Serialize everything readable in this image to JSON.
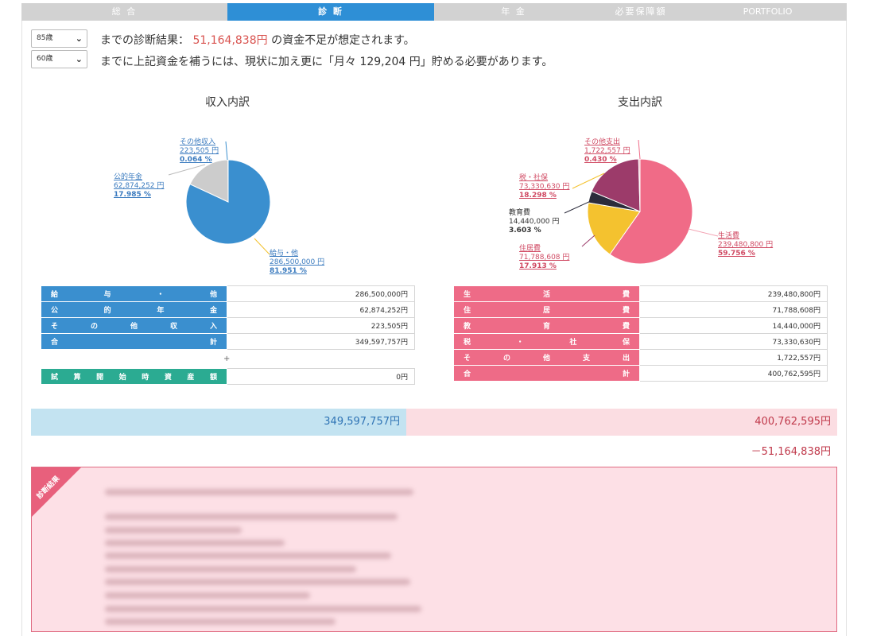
{
  "tabs": [
    {
      "label": "総 合"
    },
    {
      "label": "診 断"
    },
    {
      "label": "年 金"
    },
    {
      "label": "必要保障額"
    },
    {
      "label": "PORTFOLIO"
    }
  ],
  "filters": {
    "age_end": "85歳",
    "age_start": "60歳"
  },
  "diagnosis": {
    "line1_pre": "までの診断結果：",
    "line1_amount": "51,164,838円",
    "line1_post": "の資金不足が想定されます。",
    "line2": "までに上記資金を補うには、現状に加え更に「月々 129,204 円」貯める必要があります。"
  },
  "income": {
    "title": "収入内訳",
    "labels": [
      {
        "name": "その他収入",
        "value": "223,505 円",
        "pct": "0.064 %"
      },
      {
        "name": "公的年金",
        "value": "62,874,252 円",
        "pct": "17.985 %"
      },
      {
        "name": "給与・他",
        "value": "286,500,000 円",
        "pct": "81.951 %"
      }
    ],
    "rows": [
      {
        "label": [
          "給",
          "与",
          "・",
          "他"
        ],
        "value": "286,500,000円"
      },
      {
        "label": [
          "公",
          "的",
          "年",
          "金"
        ],
        "value": "62,874,252円"
      },
      {
        "label": [
          "そ",
          "の",
          "他",
          "収",
          "入"
        ],
        "value": "223,505円"
      },
      {
        "label": [
          "合",
          "計"
        ],
        "value": "349,597,757円"
      }
    ],
    "plus": "+",
    "assets": {
      "label": [
        "試",
        "算",
        "開",
        "始",
        "時",
        "資",
        "産",
        "額"
      ],
      "value": "0円"
    }
  },
  "expense": {
    "title": "支出内訳",
    "labels": [
      {
        "name": "その他支出",
        "value": "1,722,557 円",
        "pct": "0.430 %"
      },
      {
        "name": "税・社保",
        "value": "73,330,630 円",
        "pct": "18.298 %"
      },
      {
        "name": "教育費",
        "value": "14,440,000 円",
        "pct": "3.603 %"
      },
      {
        "name": "住居費",
        "value": "71,788,608 円",
        "pct": "17.913 %"
      },
      {
        "name": "生活費",
        "value": "239,480,800 円",
        "pct": "59.756 %"
      }
    ],
    "rows": [
      {
        "label": [
          "生",
          "活",
          "費"
        ],
        "value": "239,480,800円"
      },
      {
        "label": [
          "住",
          "居",
          "費"
        ],
        "value": "71,788,608円"
      },
      {
        "label": [
          "教",
          "育",
          "費"
        ],
        "value": "14,440,000円"
      },
      {
        "label": [
          "税",
          "・",
          "社",
          "保"
        ],
        "value": "73,330,630円"
      },
      {
        "label": [
          "そ",
          "の",
          "他",
          "支",
          "出"
        ],
        "value": "1,722,557円"
      },
      {
        "label": [
          "合",
          "計"
        ],
        "value": "400,762,595円"
      }
    ]
  },
  "totals": {
    "income": "349,597,757円",
    "expense": "400,762,595円",
    "deficit": "－51,164,838円"
  },
  "result": {
    "ribbon": "診断結果"
  },
  "chart_data": [
    {
      "type": "pie",
      "title": "収入内訳",
      "categories": [
        "給与・他",
        "公的年金",
        "その他収入"
      ],
      "values": [
        286500000,
        62874252,
        223505
      ],
      "percent": [
        81.951,
        17.985,
        0.064
      ],
      "colors": [
        "#3a8fcf",
        "#cccccc",
        "#f2c12e"
      ]
    },
    {
      "type": "pie",
      "title": "支出内訳",
      "categories": [
        "生活費",
        "住居費",
        "教育費",
        "税・社保",
        "その他支出"
      ],
      "values": [
        239480800,
        71788608,
        14440000,
        73330630,
        1722557
      ],
      "percent": [
        59.756,
        17.913,
        3.603,
        18.298,
        0.43
      ],
      "colors": [
        "#f06b87",
        "#f4c22f",
        "#2b2b3b",
        "#9c3b6a",
        "#f3a4b4"
      ]
    }
  ]
}
